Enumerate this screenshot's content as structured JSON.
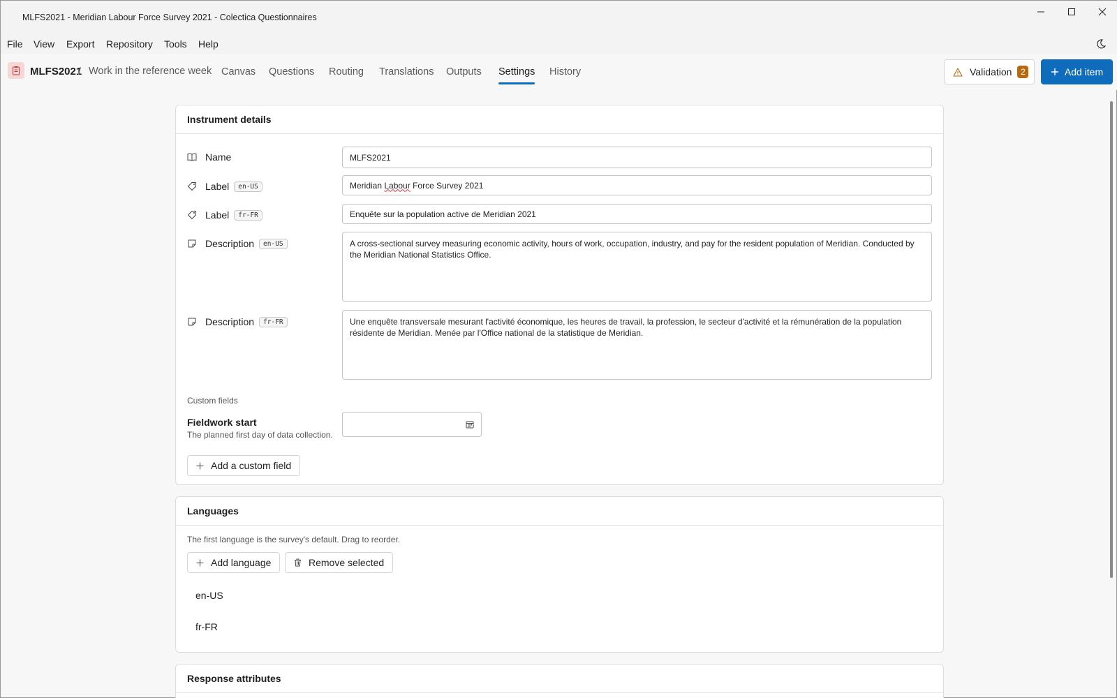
{
  "window": {
    "title": "MLFS2021 - Meridian Labour Force Survey 2021 - Colectica Questionnaires"
  },
  "menu": {
    "items": [
      "File",
      "View",
      "Export",
      "Repository",
      "Tools",
      "Help"
    ]
  },
  "nav": {
    "root": "MLFS2021",
    "separator": "/",
    "current": "Work in the reference week",
    "tabs": [
      "Canvas",
      "Questions",
      "Routing",
      "Translations",
      "Outputs",
      "Settings",
      "History"
    ],
    "active_tab": "Settings",
    "validation_label": "Validation",
    "validation_count": "2",
    "add_item_label": "Add item"
  },
  "instrument": {
    "header": "Instrument details",
    "name_label": "Name",
    "name_value": "MLFS2021",
    "label_label": "Label",
    "label_en_tag": "en-US",
    "label_en_value_pre": "Meridian ",
    "label_en_value_mis": "Labour",
    "label_en_value_post": " Force Survey 2021",
    "label_fr_tag": "fr-FR",
    "label_fr_value": "Enquête sur la population active de Meridian 2021",
    "description_label": "Description",
    "desc_en_tag": "en-US",
    "desc_en_value": "A cross-sectional survey measuring economic activity, hours of work, occupation, industry, and pay for the resident population of Meridian. Conducted by the Meridian National Statistics Office.",
    "desc_fr_tag": "fr-FR",
    "desc_fr_value": "Une enquête transversale mesurant l'activité économique, les heures de travail, la profession, le secteur d'activité et la rémunération de la population résidente de Meridian. Menée par l'Office national de la statistique de Meridian.",
    "custom_fields_caption": "Custom fields",
    "fieldwork_title": "Fieldwork start",
    "fieldwork_desc": "The planned first day of data collection.",
    "add_custom_field": "Add a custom field"
  },
  "languages": {
    "header": "Languages",
    "hint": "The first language is the survey's default. Drag to reorder.",
    "add_language": "Add language",
    "remove_selected": "Remove selected",
    "items": [
      "en-US",
      "fr-FR"
    ]
  },
  "response_attributes": {
    "header": "Response attributes"
  },
  "colors": {
    "accent": "#0f6cbd",
    "badge": "#b8690f",
    "tab_underline": "#0f6cbd",
    "app_icon_bg": "#f7d6d6"
  },
  "icons": {
    "minimize": "minimize-icon",
    "maximize": "maximize-icon",
    "close": "close-icon",
    "theme": "moon-icon",
    "app": "clipboard-icon",
    "warning": "warning-icon",
    "plus": "plus-icon",
    "name": "book-icon",
    "label": "tag-icon",
    "description": "note-icon",
    "calendar": "calendar-icon",
    "trash": "trash-icon"
  }
}
